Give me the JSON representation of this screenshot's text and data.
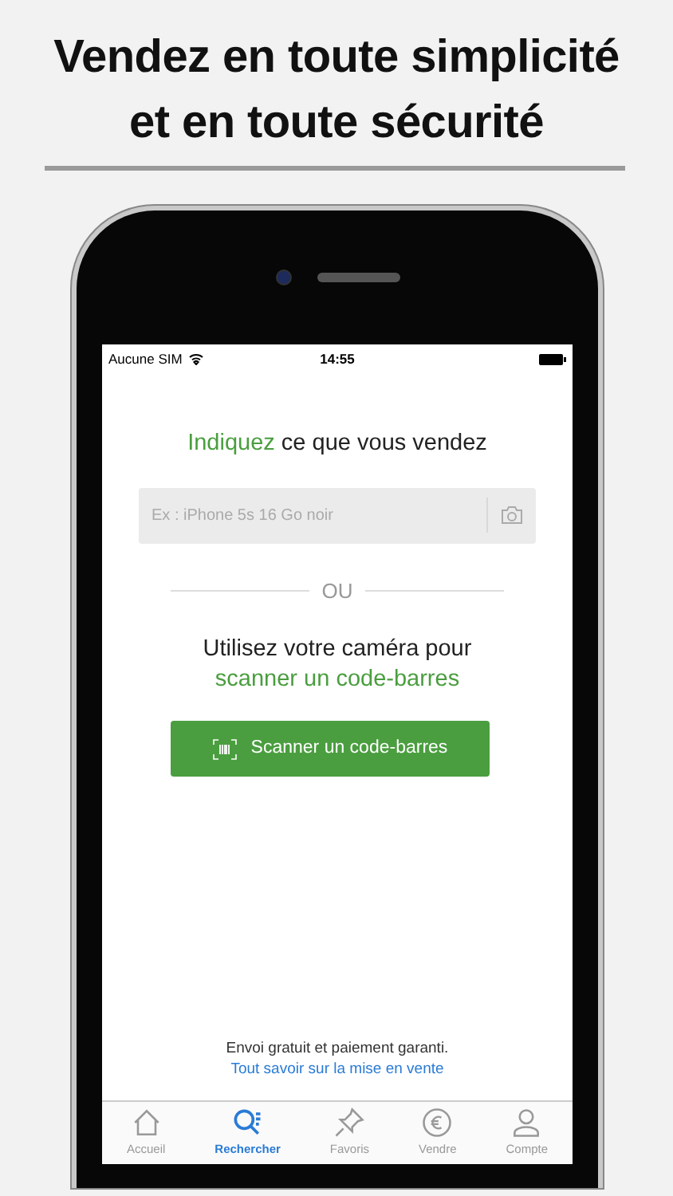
{
  "headline": [
    "Vendez en toute simplicité",
    "et en toute sécurité"
  ],
  "status_bar": {
    "carrier": "Aucune SIM",
    "time": "14:55"
  },
  "prompt": {
    "highlight": "Indiquez",
    "text": "ce que vous vendez"
  },
  "search": {
    "placeholder": "Ex : iPhone 5s 16 Go noir"
  },
  "separator": "OU",
  "camera_text": [
    "Utilisez votre caméra pour",
    "scanner un code-barres"
  ],
  "scan_button": "Scanner un code-barres",
  "footer": {
    "text": "Envoi gratuit et paiement garanti.",
    "link": "Tout savoir sur la mise en vente"
  },
  "tabs": [
    {
      "kind": "home",
      "label": "Accueil",
      "selected": false
    },
    {
      "kind": "search",
      "label": "Rechercher",
      "selected": true
    },
    {
      "kind": "pin",
      "label": "Favoris",
      "selected": false
    },
    {
      "kind": "euro",
      "label": "Vendre",
      "selected": false
    },
    {
      "kind": "person",
      "label": "Compte",
      "selected": false
    }
  ]
}
